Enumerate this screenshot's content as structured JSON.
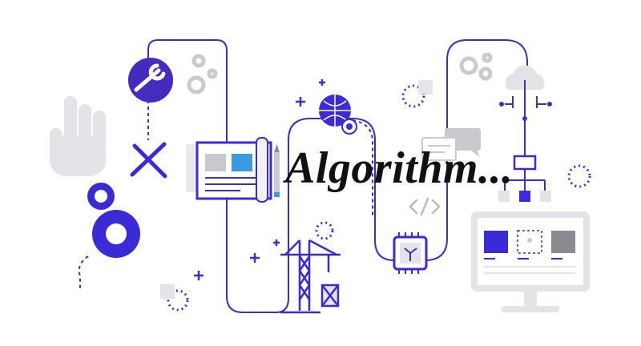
{
  "headline": {
    "text": "Algorithm...",
    "color": "#111111"
  },
  "colors": {
    "primary": "#3b2bd6",
    "accent": "#3a9be0",
    "purple": "#5c2d91",
    "light_gray": "#e5e5ea",
    "mid_gray": "#b9b9c0",
    "dark_gray": "#8a8a90"
  },
  "icons": [
    "hand-icon",
    "wrench-badge-icon",
    "gears-icon",
    "tools-icon",
    "blueprint-icon",
    "pencil-icon",
    "globe-icon",
    "crane-icon",
    "chat-bubbles-icon",
    "code-tag-icon",
    "chip-icon",
    "cloud-network-icon",
    "flowchart-icon",
    "monitor-icon"
  ]
}
